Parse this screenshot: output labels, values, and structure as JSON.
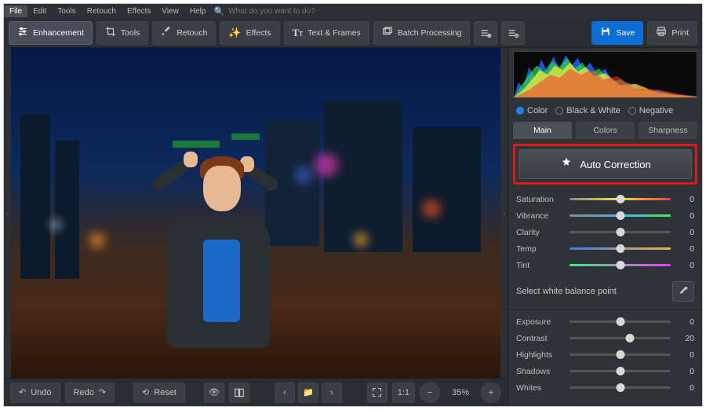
{
  "menu": {
    "items": [
      "File",
      "Edit",
      "Tools",
      "Retouch",
      "Effects",
      "View",
      "Help"
    ],
    "active_index": 0,
    "search_placeholder": "What do you want to do?"
  },
  "toolbar": {
    "enhancement": "Enhancement",
    "tools": "Tools",
    "retouch": "Retouch",
    "effects": "Effects",
    "text_frames": "Text & Frames",
    "batch": "Batch Processing",
    "save": "Save",
    "print": "Print"
  },
  "bottom": {
    "undo": "Undo",
    "redo": "Redo",
    "reset": "Reset",
    "ratio": "1:1",
    "zoom": "35%"
  },
  "panel": {
    "modes": {
      "color": "Color",
      "bw": "Black & White",
      "negative": "Negative"
    },
    "tabs": {
      "main": "Main",
      "colors": "Colors",
      "sharpness": "Sharpness"
    },
    "auto": "Auto Correction",
    "wb_label": "Select white balance point",
    "sliders": {
      "saturation": {
        "label": "Saturation",
        "value": "0"
      },
      "vibrance": {
        "label": "Vibrance",
        "value": "0"
      },
      "clarity": {
        "label": "Clarity",
        "value": "0"
      },
      "temp": {
        "label": "Temp",
        "value": "0"
      },
      "tint": {
        "label": "Tint",
        "value": "0"
      },
      "exposure": {
        "label": "Exposure",
        "value": "0"
      },
      "contrast": {
        "label": "Contrast",
        "value": "20"
      },
      "highlights": {
        "label": "Highlights",
        "value": "0"
      },
      "shadows": {
        "label": "Shadows",
        "value": "0"
      },
      "whites": {
        "label": "Whites",
        "value": "0"
      }
    }
  }
}
